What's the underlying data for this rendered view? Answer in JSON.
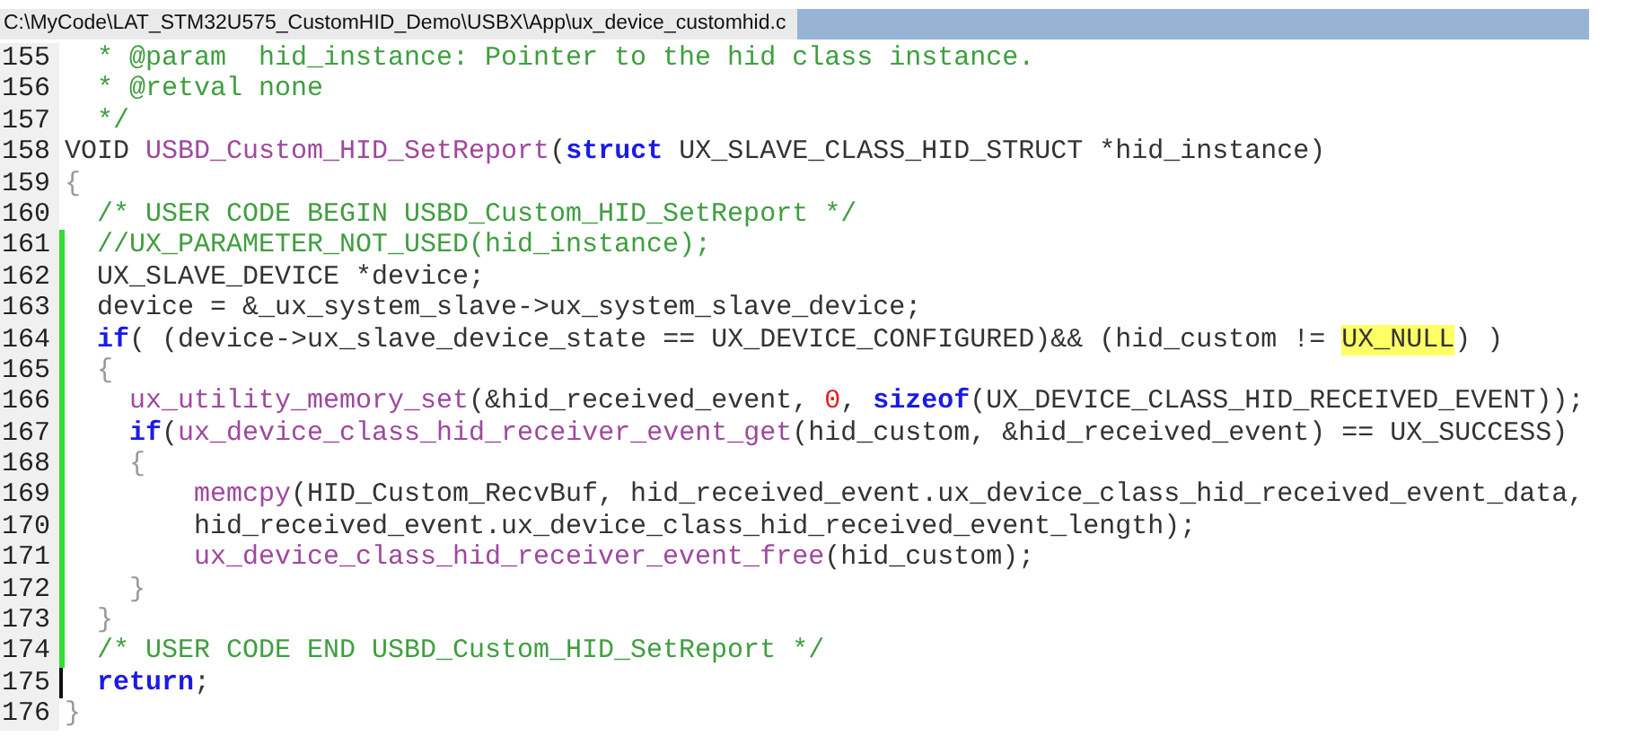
{
  "window": {
    "title": "C:\\MyCode\\LAT_STM32U575_CustomHID_Demo\\USBX\\App\\ux_device_customhid.c"
  },
  "lines": [
    {
      "number": "155",
      "changed": false,
      "caret": false,
      "segments": [
        {
          "kind": "comment",
          "text": "  * @param  hid_instance: Pointer to the hid class instance."
        }
      ]
    },
    {
      "number": "156",
      "changed": false,
      "caret": false,
      "segments": [
        {
          "kind": "comment",
          "text": "  * @retval none"
        }
      ]
    },
    {
      "number": "157",
      "changed": false,
      "caret": false,
      "segments": [
        {
          "kind": "comment",
          "text": "  */"
        }
      ]
    },
    {
      "number": "158",
      "changed": false,
      "caret": false,
      "segments": [
        {
          "kind": "plain",
          "text": "VOID "
        },
        {
          "kind": "function",
          "text": "USBD_Custom_HID_SetReport"
        },
        {
          "kind": "plain",
          "text": "("
        },
        {
          "kind": "keyword",
          "text": "struct"
        },
        {
          "kind": "plain",
          "text": " UX_SLAVE_CLASS_HID_STRUCT *hid_instance)"
        }
      ]
    },
    {
      "number": "159",
      "changed": false,
      "caret": false,
      "segments": [
        {
          "kind": "brace",
          "text": "{"
        }
      ]
    },
    {
      "number": "160",
      "changed": false,
      "caret": false,
      "segments": [
        {
          "kind": "comment",
          "text": "  /* USER CODE BEGIN USBD_Custom_HID_SetReport */"
        }
      ]
    },
    {
      "number": "161",
      "changed": true,
      "caret": false,
      "segments": [
        {
          "kind": "comment",
          "text": "  //UX_PARAMETER_NOT_USED(hid_instance);"
        }
      ]
    },
    {
      "number": "162",
      "changed": true,
      "caret": false,
      "segments": [
        {
          "kind": "plain",
          "text": "  UX_SLAVE_DEVICE *device;"
        }
      ]
    },
    {
      "number": "163",
      "changed": true,
      "caret": false,
      "segments": [
        {
          "kind": "plain",
          "text": "  device = &_ux_system_slave->ux_system_slave_device;"
        }
      ]
    },
    {
      "number": "164",
      "changed": true,
      "caret": false,
      "segments": [
        {
          "kind": "keyword",
          "text": "  if"
        },
        {
          "kind": "plain",
          "text": "( (device->ux_slave_device_state == UX_DEVICE_CONFIGURED)&& (hid_custom != "
        },
        {
          "kind": "highlight",
          "text": "UX_NULL"
        },
        {
          "kind": "plain",
          "text": ") )"
        }
      ]
    },
    {
      "number": "165",
      "changed": true,
      "caret": false,
      "segments": [
        {
          "kind": "brace",
          "text": "  {"
        }
      ]
    },
    {
      "number": "166",
      "changed": true,
      "caret": false,
      "segments": [
        {
          "kind": "function",
          "text": "    ux_utility_memory_set"
        },
        {
          "kind": "plain",
          "text": "(&hid_received_event, "
        },
        {
          "kind": "number",
          "text": "0"
        },
        {
          "kind": "plain",
          "text": ", "
        },
        {
          "kind": "keyword",
          "text": "sizeof"
        },
        {
          "kind": "plain",
          "text": "(UX_DEVICE_CLASS_HID_RECEIVED_EVENT));"
        }
      ]
    },
    {
      "number": "167",
      "changed": true,
      "caret": false,
      "segments": [
        {
          "kind": "keyword",
          "text": "    if"
        },
        {
          "kind": "plain",
          "text": "("
        },
        {
          "kind": "function",
          "text": "ux_device_class_hid_receiver_event_get"
        },
        {
          "kind": "plain",
          "text": "(hid_custom, &hid_received_event) == UX_SUCCESS)"
        }
      ]
    },
    {
      "number": "168",
      "changed": true,
      "caret": false,
      "segments": [
        {
          "kind": "brace",
          "text": "    {"
        }
      ]
    },
    {
      "number": "169",
      "changed": true,
      "caret": false,
      "segments": [
        {
          "kind": "function",
          "text": "        memcpy"
        },
        {
          "kind": "plain",
          "text": "(HID_Custom_RecvBuf, hid_received_event.ux_device_class_hid_received_event_data,"
        }
      ]
    },
    {
      "number": "170",
      "changed": true,
      "caret": false,
      "segments": [
        {
          "kind": "plain",
          "text": "        hid_received_event.ux_device_class_hid_received_event_length);"
        }
      ]
    },
    {
      "number": "171",
      "changed": true,
      "caret": false,
      "segments": [
        {
          "kind": "function",
          "text": "        ux_device_class_hid_receiver_event_free"
        },
        {
          "kind": "plain",
          "text": "(hid_custom);"
        }
      ]
    },
    {
      "number": "172",
      "changed": true,
      "caret": false,
      "segments": [
        {
          "kind": "brace",
          "text": "    }"
        }
      ]
    },
    {
      "number": "173",
      "changed": true,
      "caret": false,
      "segments": [
        {
          "kind": "brace",
          "text": "  }"
        }
      ]
    },
    {
      "number": "174",
      "changed": true,
      "caret": false,
      "segments": [
        {
          "kind": "comment",
          "text": "  /* USER CODE END USBD_Custom_HID_SetReport */"
        }
      ]
    },
    {
      "number": "175",
      "changed": false,
      "caret": true,
      "segments": [
        {
          "kind": "keyword",
          "text": "  return"
        },
        {
          "kind": "plain",
          "text": ";"
        }
      ]
    },
    {
      "number": "176",
      "changed": false,
      "caret": false,
      "segments": [
        {
          "kind": "brace",
          "text": "}"
        }
      ]
    }
  ]
}
